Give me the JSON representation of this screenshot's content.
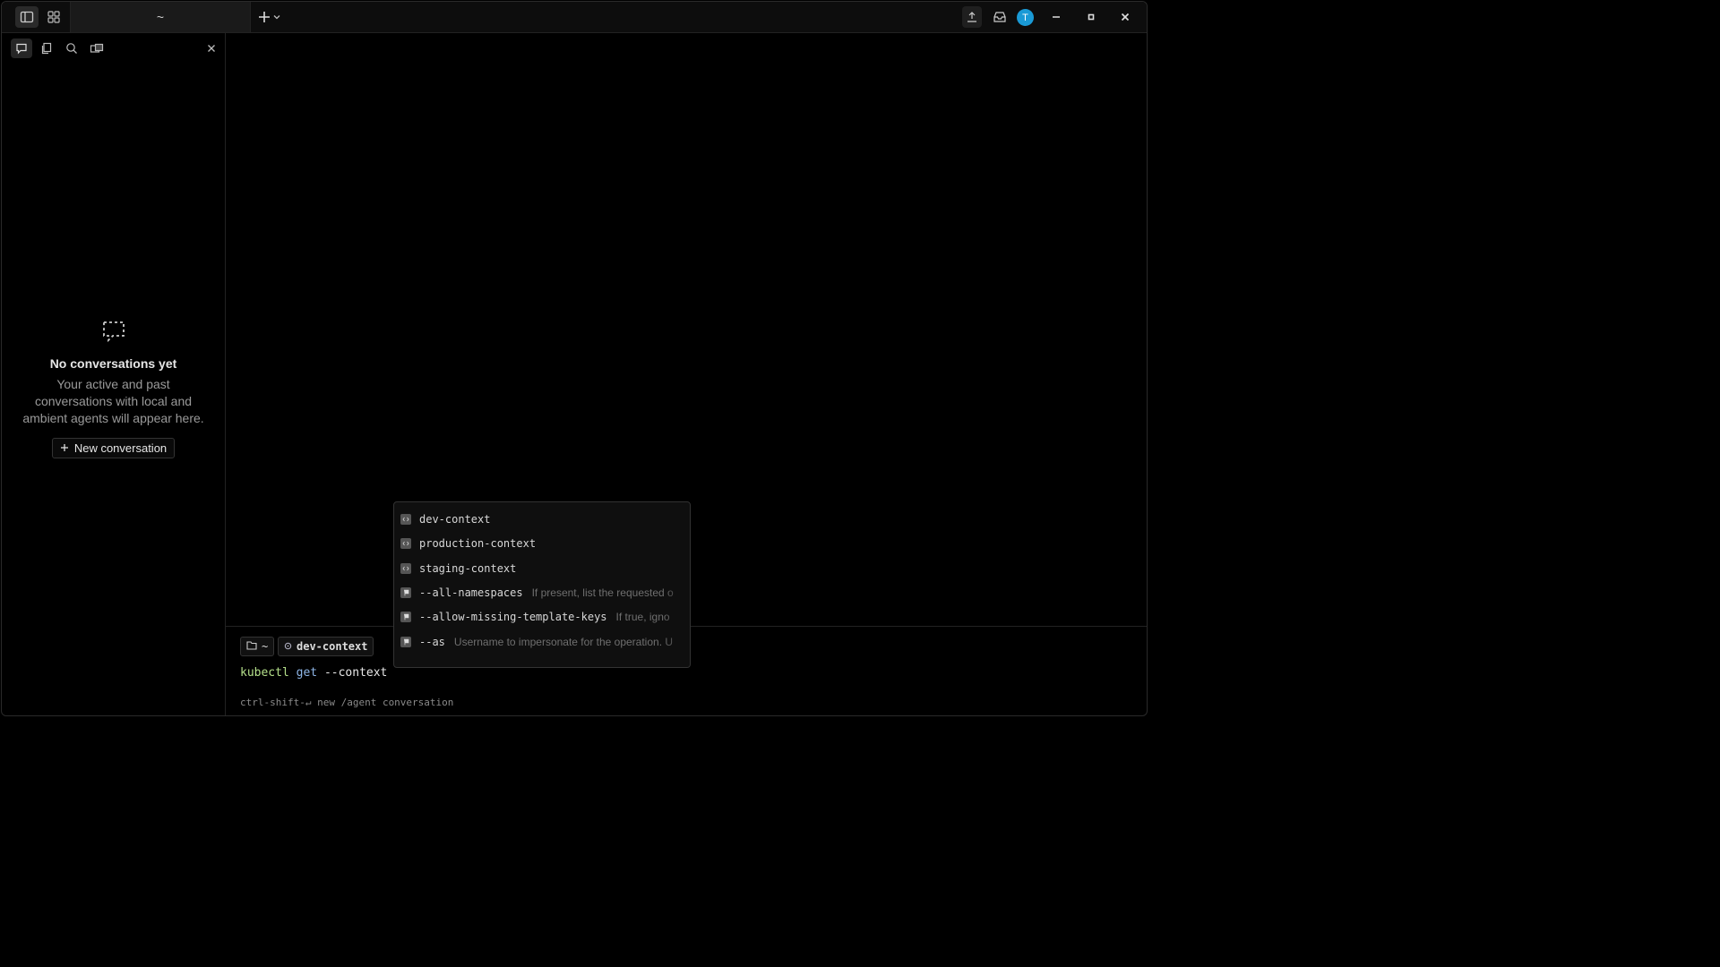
{
  "titlebar": {
    "tab_title": "~",
    "avatar_letter": "T"
  },
  "sidebar": {
    "empty_title": "No conversations yet",
    "empty_description": "Your active and past conversations with local and ambient agents will appear here.",
    "new_conversation_label": "New conversation"
  },
  "input": {
    "dir_chip": "~",
    "context_chip": "dev-context",
    "command": {
      "program": "kubectl",
      "verb": "get",
      "arg": "--context"
    },
    "hint": "ctrl-shift-↵ new /agent conversation"
  },
  "completions": [
    {
      "label": "dev-context",
      "desc": ""
    },
    {
      "label": "production-context",
      "desc": ""
    },
    {
      "label": "staging-context",
      "desc": ""
    },
    {
      "label": "--all-namespaces",
      "desc": "If present, list the requested o"
    },
    {
      "label": "--allow-missing-template-keys",
      "desc": "If true, igno"
    },
    {
      "label": "--as",
      "desc": "Username to impersonate for the operation. U"
    }
  ],
  "colors": {
    "accent": "#1a9ad6",
    "program": "#b5e08a",
    "verb": "#8fb7e8"
  }
}
